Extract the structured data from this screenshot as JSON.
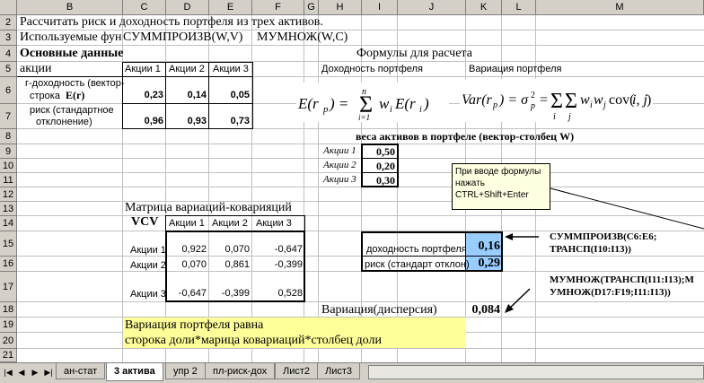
{
  "columns": [
    "B",
    "C",
    "D",
    "E",
    "F",
    "G",
    "H",
    "I",
    "J",
    "K",
    "L",
    "M"
  ],
  "rows": [
    "2",
    "3",
    "4",
    "5",
    "6",
    "7",
    "8",
    "9",
    "10",
    "11",
    "12",
    "13",
    "14",
    "15",
    "16",
    "17",
    "18",
    "19",
    "20",
    "21"
  ],
  "title": "Рассчитать риск и доходность портфеля из трех активов.",
  "used_functions": {
    "label": "Используемые фун",
    "func1": "СУММПРОИЗВ(W,V)",
    "func2": "МУМНОЖ(W,C)"
  },
  "main_data_header": "Основные данные",
  "formulas_header": "Формулы для расчета",
  "assets_label": "акции",
  "asset_names": [
    "Акции 1",
    "Акции 2",
    "Акции 3"
  ],
  "returns_row": {
    "label1": "г-доходность (вектор-",
    "label2": "строка",
    "label_bold": "E(r)",
    "values": [
      "0,23",
      "0,14",
      "0,05"
    ]
  },
  "risk_row": {
    "label1": "риск (стандартное",
    "label2": "отклонение)",
    "values": [
      "0,96",
      "0,93",
      "0,73"
    ]
  },
  "portfolio_return_label": "Доходность портфеля",
  "portfolio_variance_label": "Вариация портфеля",
  "weights_header": "веса активов в портфеле (вектор-столбец W)",
  "weights": [
    {
      "name": "Акции 1",
      "value": "0,50"
    },
    {
      "name": "Акции 2",
      "value": "0,20"
    },
    {
      "name": "Акции 3",
      "value": "0,30"
    }
  ],
  "tooltip": {
    "line1": "При вводе формулы",
    "line2": "нажать",
    "line3": "CTRL+Shift+Enter"
  },
  "vcv_title": "Матрица вариаций-коварияций",
  "vcv_label": "VCV",
  "vcv_rows": [
    {
      "name": "Акции 1",
      "values": [
        "0,922",
        "0,070",
        "-0,647"
      ]
    },
    {
      "name": "Акции 2",
      "values": [
        "0,070",
        "0,861",
        "-0,399"
      ]
    },
    {
      "name": "Акции 3",
      "values": [
        "-0,647",
        "-0,399",
        "0,528"
      ]
    }
  ],
  "result_return": {
    "label": "доходность портфеля",
    "value": "0,16"
  },
  "result_risk": {
    "label": "риск (стандарт отклон)",
    "value": "0,29"
  },
  "note1": {
    "line1": "СУММПРОИЗВ(C6:E6;",
    "line2": "ТРАНСП(I10:I13))"
  },
  "note2": {
    "line1": "МУМНОЖ(ТРАНСП(I11:I13);М",
    "line2": "УМНОЖ(D17:F19;I11:I13))"
  },
  "variance": {
    "label": "Вариация(дисперсия)",
    "value": "0,084"
  },
  "yellow_note": {
    "line1": "Вариация портфеля равна",
    "line2": "сторока доли*марица ковариаций*столбец доли"
  },
  "sheet_tabs": [
    "ан-стат",
    "3 актива",
    "упр 2",
    "пл-риск-дох",
    "Лист2",
    "Лист3"
  ],
  "active_tab": "3 актива",
  "colors": {
    "header_bg": "#d4d0c8",
    "highlight_cyan": "#99ccff",
    "yellow_note": "#ffff99",
    "tooltip_bg": "#ffffe1"
  }
}
